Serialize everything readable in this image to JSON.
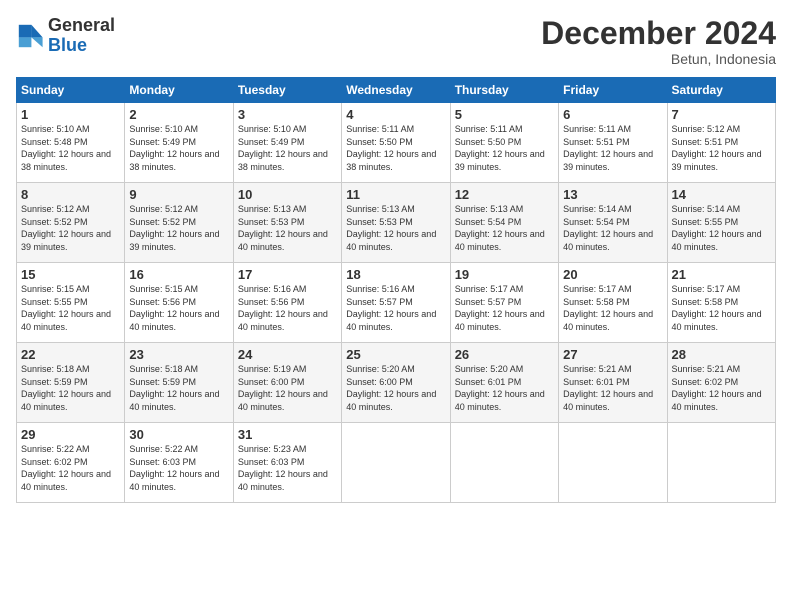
{
  "header": {
    "logo_text_general": "General",
    "logo_text_blue": "Blue",
    "month_title": "December 2024",
    "location": "Betun, Indonesia"
  },
  "weekdays": [
    "Sunday",
    "Monday",
    "Tuesday",
    "Wednesday",
    "Thursday",
    "Friday",
    "Saturday"
  ],
  "weeks": [
    [
      {
        "day": "1",
        "sunrise": "5:10 AM",
        "sunset": "5:48 PM",
        "daylight": "12 hours and 38 minutes."
      },
      {
        "day": "2",
        "sunrise": "5:10 AM",
        "sunset": "5:49 PM",
        "daylight": "12 hours and 38 minutes."
      },
      {
        "day": "3",
        "sunrise": "5:10 AM",
        "sunset": "5:49 PM",
        "daylight": "12 hours and 38 minutes."
      },
      {
        "day": "4",
        "sunrise": "5:11 AM",
        "sunset": "5:50 PM",
        "daylight": "12 hours and 38 minutes."
      },
      {
        "day": "5",
        "sunrise": "5:11 AM",
        "sunset": "5:50 PM",
        "daylight": "12 hours and 39 minutes."
      },
      {
        "day": "6",
        "sunrise": "5:11 AM",
        "sunset": "5:51 PM",
        "daylight": "12 hours and 39 minutes."
      },
      {
        "day": "7",
        "sunrise": "5:12 AM",
        "sunset": "5:51 PM",
        "daylight": "12 hours and 39 minutes."
      }
    ],
    [
      {
        "day": "8",
        "sunrise": "5:12 AM",
        "sunset": "5:52 PM",
        "daylight": "12 hours and 39 minutes."
      },
      {
        "day": "9",
        "sunrise": "5:12 AM",
        "sunset": "5:52 PM",
        "daylight": "12 hours and 39 minutes."
      },
      {
        "day": "10",
        "sunrise": "5:13 AM",
        "sunset": "5:53 PM",
        "daylight": "12 hours and 40 minutes."
      },
      {
        "day": "11",
        "sunrise": "5:13 AM",
        "sunset": "5:53 PM",
        "daylight": "12 hours and 40 minutes."
      },
      {
        "day": "12",
        "sunrise": "5:13 AM",
        "sunset": "5:54 PM",
        "daylight": "12 hours and 40 minutes."
      },
      {
        "day": "13",
        "sunrise": "5:14 AM",
        "sunset": "5:54 PM",
        "daylight": "12 hours and 40 minutes."
      },
      {
        "day": "14",
        "sunrise": "5:14 AM",
        "sunset": "5:55 PM",
        "daylight": "12 hours and 40 minutes."
      }
    ],
    [
      {
        "day": "15",
        "sunrise": "5:15 AM",
        "sunset": "5:55 PM",
        "daylight": "12 hours and 40 minutes."
      },
      {
        "day": "16",
        "sunrise": "5:15 AM",
        "sunset": "5:56 PM",
        "daylight": "12 hours and 40 minutes."
      },
      {
        "day": "17",
        "sunrise": "5:16 AM",
        "sunset": "5:56 PM",
        "daylight": "12 hours and 40 minutes."
      },
      {
        "day": "18",
        "sunrise": "5:16 AM",
        "sunset": "5:57 PM",
        "daylight": "12 hours and 40 minutes."
      },
      {
        "day": "19",
        "sunrise": "5:17 AM",
        "sunset": "5:57 PM",
        "daylight": "12 hours and 40 minutes."
      },
      {
        "day": "20",
        "sunrise": "5:17 AM",
        "sunset": "5:58 PM",
        "daylight": "12 hours and 40 minutes."
      },
      {
        "day": "21",
        "sunrise": "5:17 AM",
        "sunset": "5:58 PM",
        "daylight": "12 hours and 40 minutes."
      }
    ],
    [
      {
        "day": "22",
        "sunrise": "5:18 AM",
        "sunset": "5:59 PM",
        "daylight": "12 hours and 40 minutes."
      },
      {
        "day": "23",
        "sunrise": "5:18 AM",
        "sunset": "5:59 PM",
        "daylight": "12 hours and 40 minutes."
      },
      {
        "day": "24",
        "sunrise": "5:19 AM",
        "sunset": "6:00 PM",
        "daylight": "12 hours and 40 minutes."
      },
      {
        "day": "25",
        "sunrise": "5:20 AM",
        "sunset": "6:00 PM",
        "daylight": "12 hours and 40 minutes."
      },
      {
        "day": "26",
        "sunrise": "5:20 AM",
        "sunset": "6:01 PM",
        "daylight": "12 hours and 40 minutes."
      },
      {
        "day": "27",
        "sunrise": "5:21 AM",
        "sunset": "6:01 PM",
        "daylight": "12 hours and 40 minutes."
      },
      {
        "day": "28",
        "sunrise": "5:21 AM",
        "sunset": "6:02 PM",
        "daylight": "12 hours and 40 minutes."
      }
    ],
    [
      {
        "day": "29",
        "sunrise": "5:22 AM",
        "sunset": "6:02 PM",
        "daylight": "12 hours and 40 minutes."
      },
      {
        "day": "30",
        "sunrise": "5:22 AM",
        "sunset": "6:03 PM",
        "daylight": "12 hours and 40 minutes."
      },
      {
        "day": "31",
        "sunrise": "5:23 AM",
        "sunset": "6:03 PM",
        "daylight": "12 hours and 40 minutes."
      },
      null,
      null,
      null,
      null
    ]
  ]
}
